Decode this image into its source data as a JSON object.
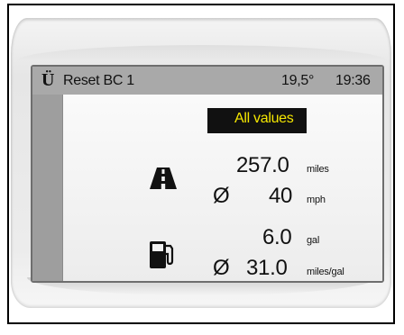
{
  "header": {
    "symbol": "Ü",
    "title": "Reset BC 1",
    "temperature": "19,5°",
    "time": "19:36"
  },
  "tab": {
    "label": "All values"
  },
  "distance": {
    "icon": "road-icon",
    "value": "257.0",
    "unit": "miles",
    "avg_symbol": "Ø",
    "avg_value": "40",
    "avg_unit": "mph"
  },
  "fuel": {
    "icon": "fuel-pump-icon",
    "value": "6.0",
    "unit": "gal",
    "avg_symbol": "Ø",
    "avg_value": "31.0",
    "avg_unit": "miles/gal"
  },
  "colors": {
    "tab_background": "#111111",
    "tab_text": "#f5e700",
    "titlebar": "#a9a9a9"
  }
}
